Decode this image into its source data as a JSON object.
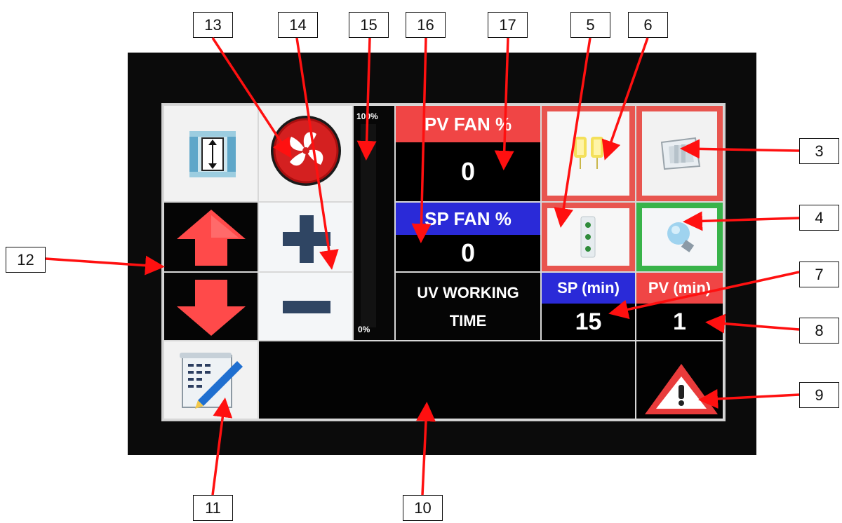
{
  "callouts": {
    "c13": "13",
    "c14": "14",
    "c15": "15",
    "c16": "16",
    "c17": "17",
    "c5": "5",
    "c6": "6",
    "c3": "3",
    "c4": "4",
    "c12": "12",
    "c7": "7",
    "c8": "8",
    "c9": "9",
    "c11": "11",
    "c10": "10"
  },
  "bar": {
    "top_label": "100%",
    "bottom_label": "0%",
    "level": 0
  },
  "pv_fan": {
    "label": "PV FAN %",
    "value": "0"
  },
  "sp_fan": {
    "label": "SP FAN %",
    "value": "0"
  },
  "uv": {
    "line1": "UV WORKING",
    "line2": "TIME"
  },
  "sp_min": {
    "label": "SP (min)",
    "value": "15"
  },
  "pv_min": {
    "label": "PV (min)",
    "value": "1"
  },
  "message": "",
  "icons": {
    "door": "door-open-close-icon",
    "fan": "fan-icon",
    "up": "arrow-up-icon",
    "down": "arrow-down-icon",
    "plus": "plus-icon",
    "minus": "minus-icon",
    "lamp": "lamp-icon",
    "socket": "socket-icon",
    "uv_lamp": "uv-lamp-icon",
    "light": "light-bulb-icon",
    "log": "log-edit-icon",
    "alarm": "alarm-warning-icon"
  },
  "colors": {
    "red_label": "#f04545",
    "blue_label": "#2a2ad8",
    "arrow_red": "#ff4040",
    "accent_green": "#38b34a"
  }
}
